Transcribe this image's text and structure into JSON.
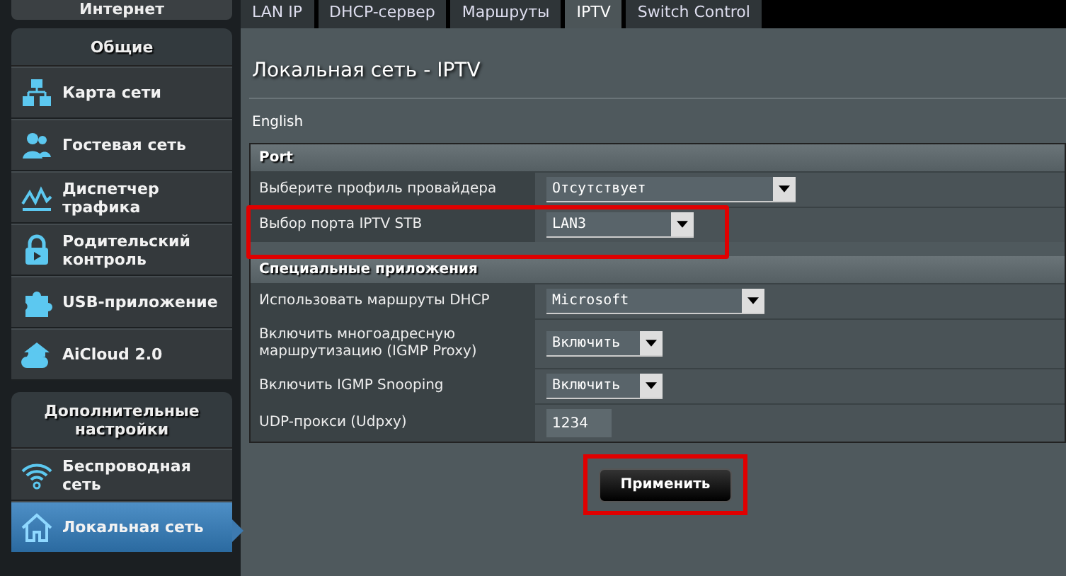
{
  "sidebar": {
    "cut_item": "Интернет",
    "groups": [
      {
        "title": "Общие",
        "items": [
          {
            "label": "Карта сети",
            "selected": false
          },
          {
            "label": "Гостевая сеть",
            "selected": false
          },
          {
            "label": "Диспетчер трафика",
            "selected": false
          },
          {
            "label": "Родительский контроль",
            "selected": false
          },
          {
            "label": "USB-приложение",
            "selected": false
          },
          {
            "label": "AiCloud 2.0",
            "selected": false
          }
        ]
      },
      {
        "title": "Дополнительные настройки",
        "items": [
          {
            "label": "Беспроводная сеть",
            "selected": false
          },
          {
            "label": "Локальная сеть",
            "selected": true
          }
        ]
      }
    ]
  },
  "tabs": [
    {
      "label": "LAN IP",
      "selected": false
    },
    {
      "label": "DHCP-сервер",
      "selected": false
    },
    {
      "label": "Маршруты",
      "selected": false
    },
    {
      "label": "IPTV",
      "selected": true
    },
    {
      "label": "Switch Control",
      "selected": false
    }
  ],
  "page_title": "Локальная сеть - IPTV",
  "language": "English",
  "sections": [
    {
      "title": "Port",
      "rows": [
        {
          "label": "Выберите профиль провайдера",
          "kind": "select",
          "value": "Отсутствует",
          "highlighted": false
        },
        {
          "label": "Выбор порта IPTV STB",
          "kind": "select",
          "value": "LAN3",
          "highlighted": true
        }
      ]
    },
    {
      "title": "Специальные приложения",
      "rows": [
        {
          "label": "Использовать маршруты DHCP",
          "kind": "select",
          "value": "Microsoft",
          "highlighted": false
        },
        {
          "label": "Включить многоадресную маршрутизацию (IGMP Proxy)",
          "kind": "select",
          "value": "Включить",
          "highlighted": false
        },
        {
          "label": "Включить IGMP Snooping",
          "kind": "select",
          "value": "Включить",
          "highlighted": false
        },
        {
          "label": "UDP-прокси (Udpxy)",
          "kind": "input",
          "value": "1234",
          "highlighted": false
        }
      ]
    }
  ],
  "apply_button": {
    "label": "Применить",
    "highlighted": true
  }
}
